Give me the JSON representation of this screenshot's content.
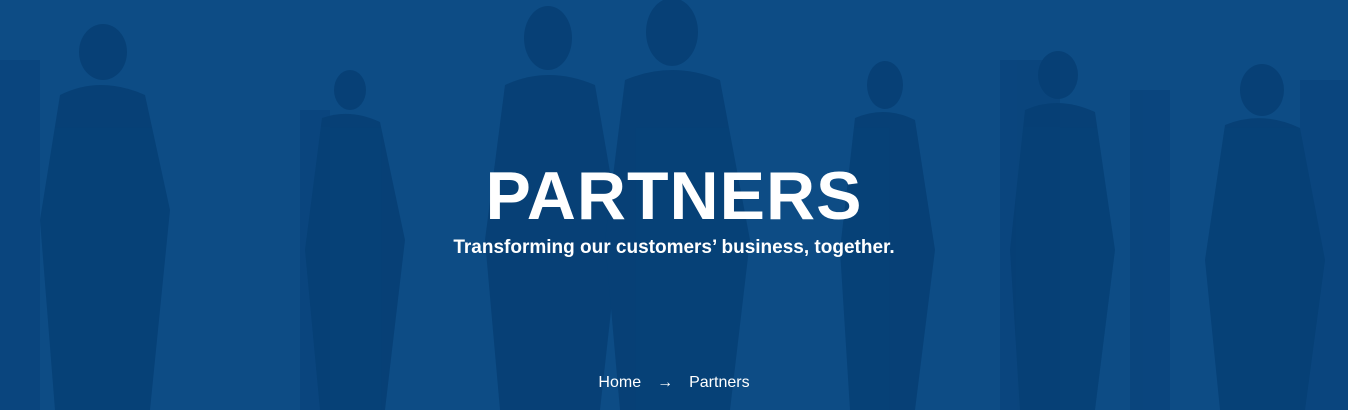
{
  "hero": {
    "title": "PARTNERS",
    "subtitle": "Transforming our customers’ business, together.",
    "background_color": "#0d4c85",
    "silhouette_color": "#063e72"
  },
  "breadcrumb": {
    "home_label": "Home",
    "separator": "→",
    "current_label": "Partners"
  }
}
